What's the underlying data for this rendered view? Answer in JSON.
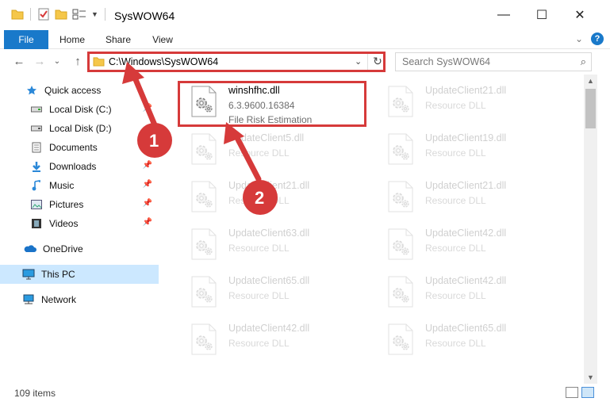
{
  "window": {
    "title": "SysWOW64",
    "minimize": "—",
    "maximize": "☐",
    "close": "✕"
  },
  "ribbon": {
    "tabs": [
      "File",
      "Home",
      "Share",
      "View"
    ],
    "expand_icon": "chevron-down-icon",
    "help": "?"
  },
  "address": {
    "path": "C:\\Windows\\SysWOW64",
    "dropdown": "⌄",
    "refresh": "↻"
  },
  "search": {
    "placeholder": "Search SysWOW64",
    "icon": "⌕"
  },
  "navigation": {
    "back": "←",
    "forward": "→",
    "recent": "⌄",
    "up": "↑"
  },
  "sidebar": {
    "items": [
      {
        "label": "Quick access",
        "icon": "star-icon"
      },
      {
        "label": "Local Disk (C:)",
        "icon": "drive-icon"
      },
      {
        "label": "Local Disk (D:)",
        "icon": "drive-icon"
      },
      {
        "label": "Documents",
        "icon": "documents-icon"
      },
      {
        "label": "Downloads",
        "icon": "download-icon"
      },
      {
        "label": "Music",
        "icon": "music-icon"
      },
      {
        "label": "Pictures",
        "icon": "pictures-icon"
      },
      {
        "label": "Videos",
        "icon": "videos-icon"
      },
      {
        "label": "OneDrive",
        "icon": "cloud-icon"
      },
      {
        "label": "This PC",
        "icon": "computer-icon"
      },
      {
        "label": "Network",
        "icon": "network-icon"
      }
    ]
  },
  "files": [
    {
      "name": "winshfhc.dll",
      "line1": "6.3.9600.16384",
      "line2": "File Risk Estimation"
    },
    {
      "name": "UpdateClient21.dll",
      "line1": "Resource DLL"
    },
    {
      "name": "UpdateClient5.dll",
      "line1": "Resource DLL"
    },
    {
      "name": "UpdateClient19.dll",
      "line1": "Resource DLL"
    },
    {
      "name": "UpdateClient21.dll",
      "line1": "Resource DLL"
    },
    {
      "name": "UpdateClient21.dll",
      "line1": "Resource DLL"
    },
    {
      "name": "UpdateClient63.dll",
      "line1": "Resource DLL"
    },
    {
      "name": "UpdateClient42.dll",
      "line1": "Resource DLL"
    },
    {
      "name": "UpdateClient65.dll",
      "line1": "Resource DLL"
    },
    {
      "name": "UpdateClient42.dll",
      "line1": "Resource DLL"
    },
    {
      "name": "UpdateClient42.dll",
      "line1": "Resource DLL"
    },
    {
      "name": "UpdateClient65.dll",
      "line1": "Resource DLL"
    }
  ],
  "status": {
    "count": "109 items"
  },
  "annotations": {
    "step1": "1",
    "step2": "2",
    "color": "#d63a3a"
  }
}
